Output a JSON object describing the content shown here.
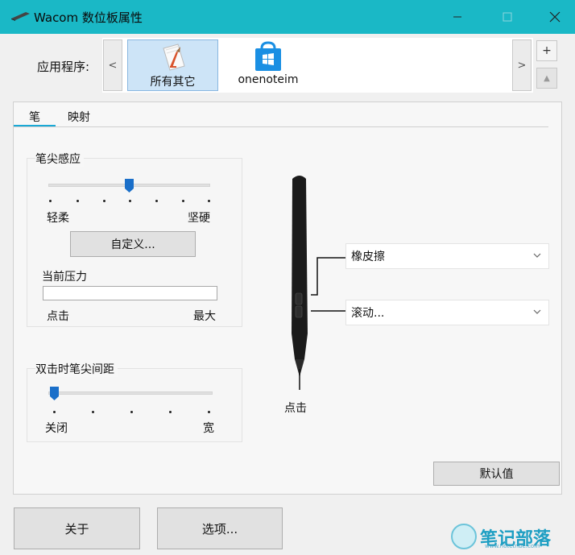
{
  "window": {
    "title": "Wacom 数位板属性"
  },
  "apps": {
    "label": "应用程序:",
    "prev_label": "<",
    "next_label": ">",
    "add_label": "+",
    "remove_label": "▲",
    "items": [
      {
        "label": "所有其它",
        "selected": true,
        "icon": "pen-document-icon"
      },
      {
        "label": "onenoteim",
        "selected": false,
        "icon": "windows-store-icon"
      }
    ]
  },
  "tabs": [
    {
      "label": "笔",
      "active": true
    },
    {
      "label": "映射",
      "active": false
    }
  ],
  "tip_feel": {
    "title": "笔尖感应",
    "min_label": "轻柔",
    "max_label": "坚硬",
    "level": 0.5,
    "customize_label": "自定义...",
    "pressure_title": "当前压力",
    "pressure_value": 0,
    "pressure_min_label": "点击",
    "pressure_max_label": "最大"
  },
  "double_click": {
    "title": "双击时笔尖间距",
    "min_label": "关闭",
    "max_label": "宽",
    "level": 0
  },
  "pen_buttons": {
    "upper": {
      "value": "橡皮擦"
    },
    "lower": {
      "value": "滚动..."
    },
    "tip_label": "点击"
  },
  "actions": {
    "default_label": "默认值",
    "about_label": "关于",
    "options_label": "选项..."
  },
  "watermark": {
    "text": "笔记部落",
    "url": "www.notetribe.com"
  },
  "colors": {
    "titlebar": "#1ab8c6",
    "selected_tile": "#cde4f7",
    "accent": "#1a6fc9"
  }
}
